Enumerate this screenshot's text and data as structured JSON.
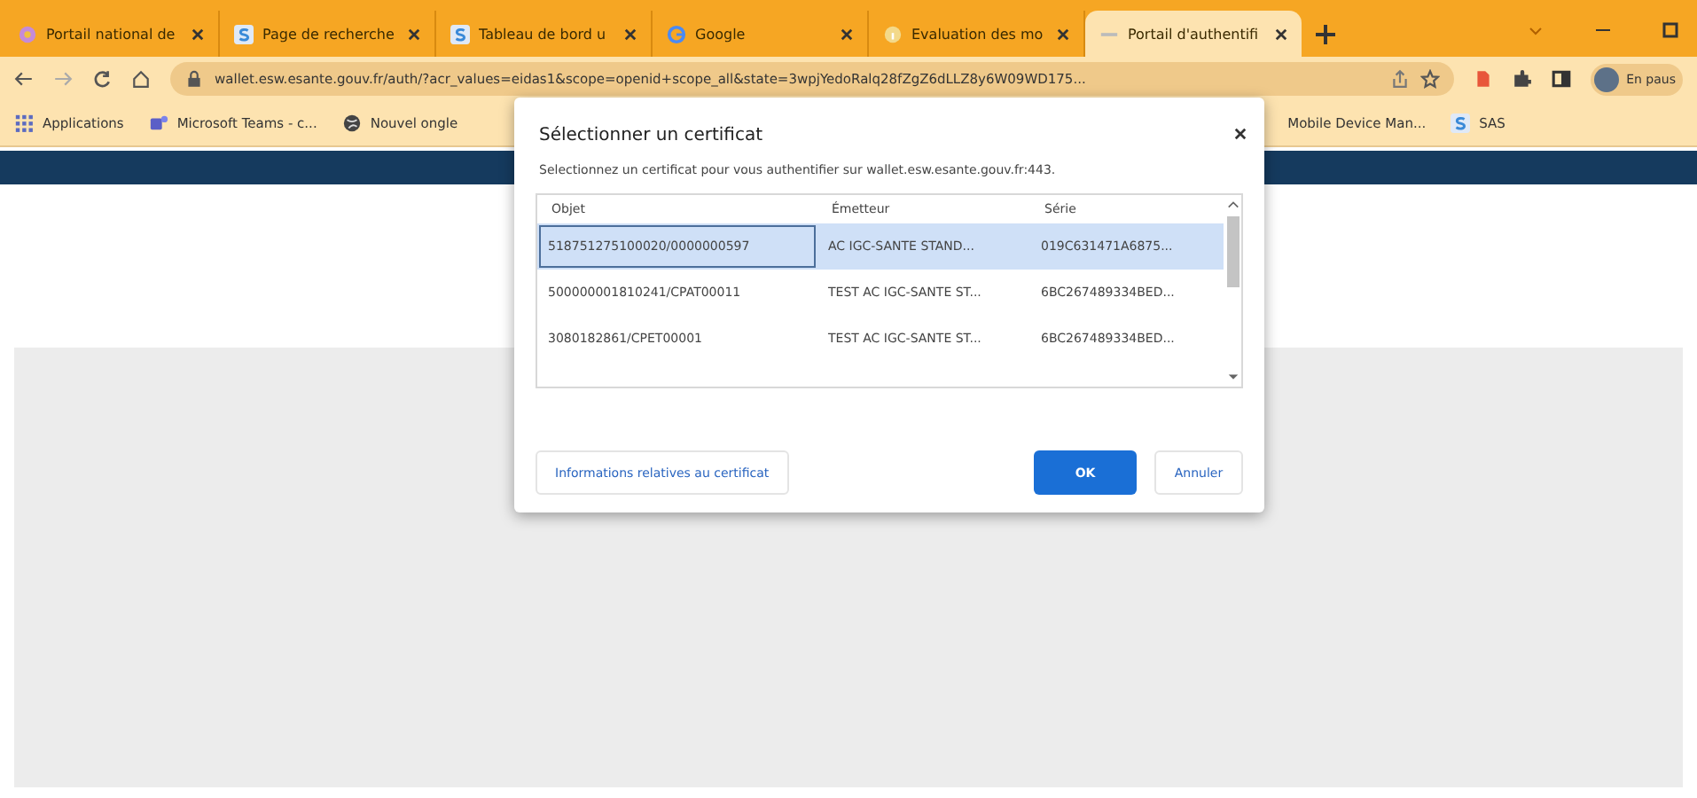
{
  "tabs": [
    {
      "title": "Portail national de",
      "selected": false
    },
    {
      "title": "Page de recherche",
      "selected": false
    },
    {
      "title": "Tableau de bord u",
      "selected": false
    },
    {
      "title": "Google",
      "selected": false
    },
    {
      "title": "Evaluation des mo",
      "selected": false
    },
    {
      "title": "Portail d'authentifi",
      "selected": true
    }
  ],
  "address_bar": {
    "url": "wallet.esw.esante.gouv.fr/auth/?acr_values=eidas1&scope=openid+scope_all&state=3wpjYedoRalq28fZgZ6dLLZ8y6W09WD175..."
  },
  "profile": {
    "label": "En paus"
  },
  "bookmarks": [
    {
      "label": "Applications"
    },
    {
      "label": "Microsoft Teams - c..."
    },
    {
      "label": "Nouvel ongle"
    },
    {
      "label": "Mobile Device Man..."
    },
    {
      "label": "SAS"
    }
  ],
  "dialog": {
    "title": "Sélectionner un certificat",
    "message": "Selectionnez un certificat pour vous authentifier sur wallet.esw.esante.gouv.fr:443.",
    "columns": [
      "Objet",
      "Émetteur",
      "Série"
    ],
    "rows": [
      {
        "cells": [
          "518751275100020/0000000597",
          "AC IGC-SANTE STAND...",
          "019C631471A6875..."
        ],
        "selected": true
      },
      {
        "cells": [
          "500000001810241/CPAT00011",
          "TEST AC IGC-SANTE ST...",
          "6BC267489334BED..."
        ],
        "selected": false
      },
      {
        "cells": [
          "3080182861/CPET00001",
          "TEST AC IGC-SANTE ST...",
          "6BC267489334BED..."
        ],
        "selected": false
      }
    ],
    "info_button": "Informations relatives au certificat",
    "ok_button": "OK",
    "cancel_button": "Annuler"
  }
}
